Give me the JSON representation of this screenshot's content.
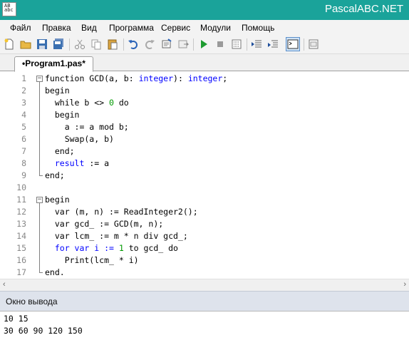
{
  "window": {
    "title": "PascalABC.NET",
    "icon_text": "AB abc"
  },
  "menu": {
    "items": [
      "Файл",
      "Правка",
      "Вид",
      "Программа",
      "Сервис",
      "Модули",
      "Помощь"
    ]
  },
  "toolbar": {
    "icons": [
      "new-file-icon",
      "open-folder-icon",
      "save-icon",
      "save-all-icon",
      "cut-icon",
      "copy-icon",
      "paste-icon",
      "undo-icon",
      "redo-icon",
      "find-icon",
      "replace-icon",
      "run-icon",
      "stop-icon",
      "debug-icon",
      "step-over-icon",
      "step-into-icon",
      "console-icon",
      "form-designer-icon"
    ]
  },
  "editor": {
    "tab_label": "•Program1.pas*",
    "lines": [
      "1",
      "2",
      "3",
      "4",
      "5",
      "6",
      "7",
      "8",
      "9",
      "10",
      "11",
      "12",
      "13",
      "14",
      "15",
      "16",
      "17"
    ],
    "code": {
      "l1": {
        "a": "function GCD(a, b: ",
        "b": "integer",
        "c": "): ",
        "d": "integer",
        "e": ";"
      },
      "l2": "begin",
      "l3": {
        "a": "  while b <> ",
        "b": "0",
        "c": " do"
      },
      "l4": "  begin",
      "l5": "    a := a mod b;",
      "l6": "    Swap(a, b)",
      "l7": "  end;",
      "l8": {
        "a": "  ",
        "b": "result",
        "c": " := a"
      },
      "l9": "end;",
      "l10": "",
      "l11": "begin",
      "l12": "  var (m, n) := ReadInteger2();",
      "l13": "  var gcd_ := GCD(m, n);",
      "l14": "  var lcm_ := m * n div gcd_;",
      "l15": {
        "a": "  for var i := ",
        "b": "1",
        "c": " to gcd_ do"
      },
      "l16": "    Print(lcm_ * i)",
      "l17": "end."
    }
  },
  "output": {
    "title": "Окно вывода",
    "lines": [
      "10 15",
      "30 60 90 120 150"
    ]
  }
}
